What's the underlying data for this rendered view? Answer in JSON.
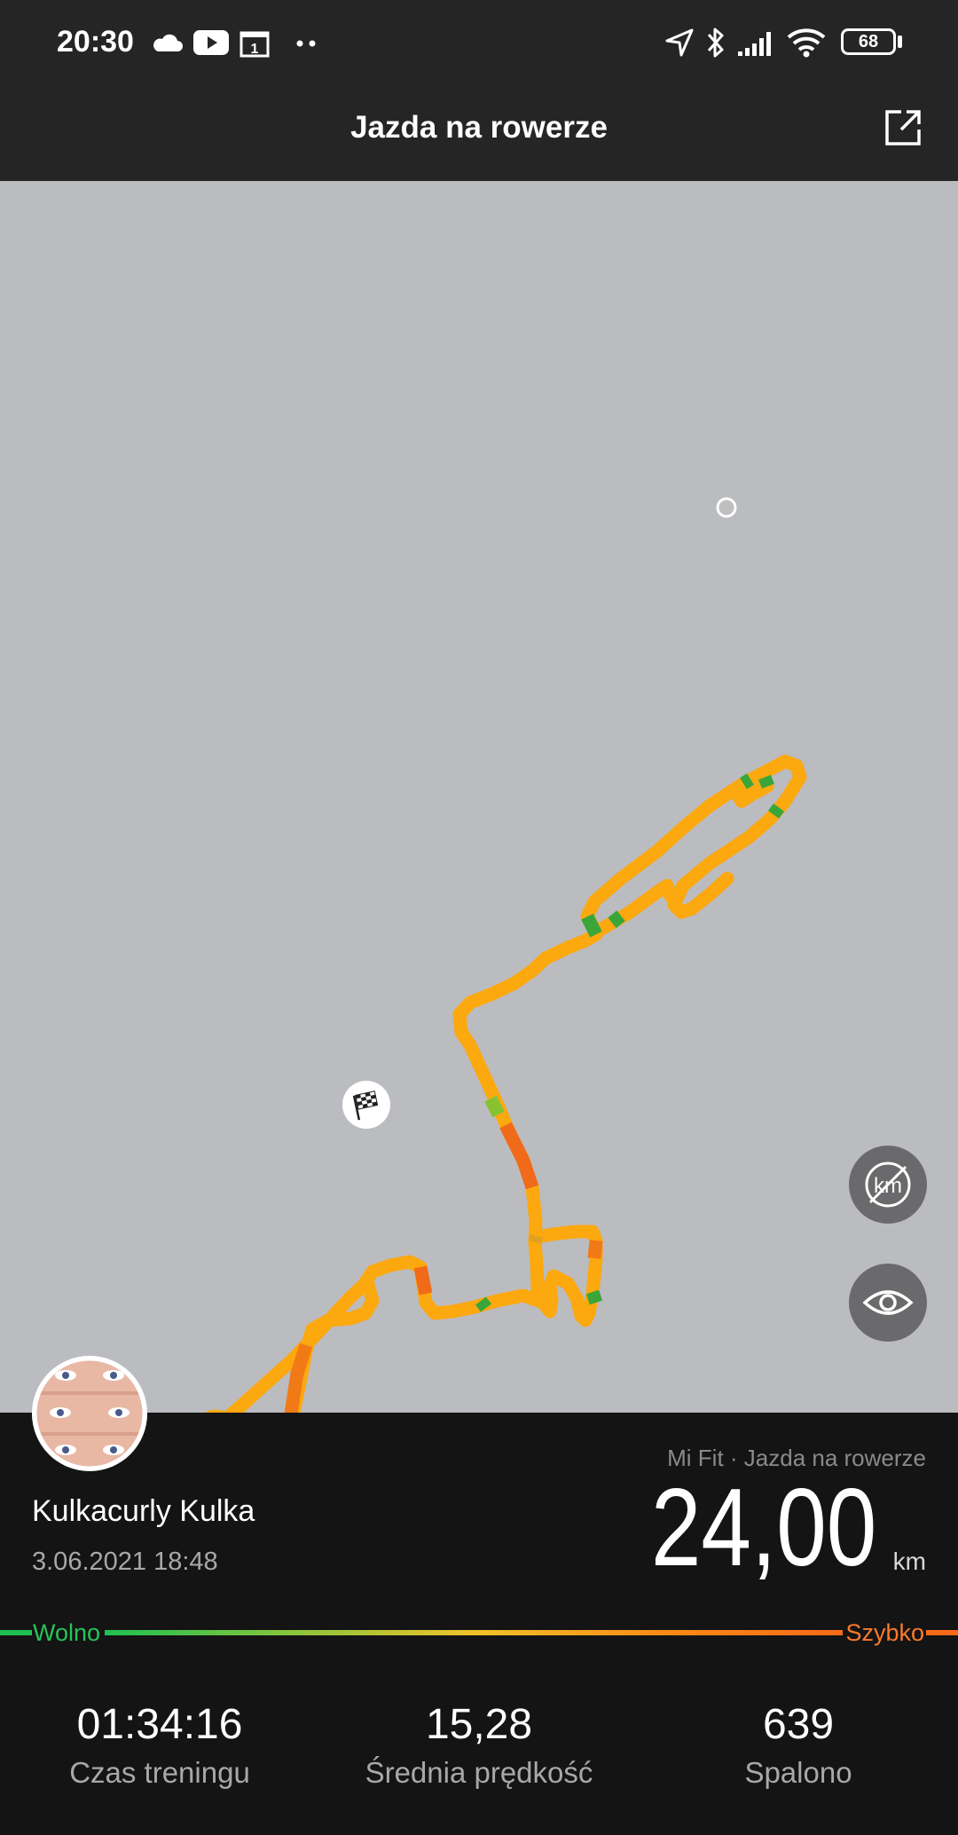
{
  "status_bar": {
    "time": "20:30",
    "battery": "68",
    "icons": [
      "cloud-icon",
      "youtube-icon",
      "calendar-icon",
      "more-dots-icon",
      "location-icon",
      "bluetooth-icon",
      "signal-icon",
      "wifi-icon",
      "battery-icon"
    ]
  },
  "header": {
    "title": "Jazda na rowerze",
    "share_icon": "share-icon"
  },
  "map": {
    "start_marker": "start-point-icon",
    "finish_marker": "finish-flag-icon",
    "buttons": [
      "hide-km-markers-icon",
      "visibility-eye-icon"
    ]
  },
  "summary": {
    "user_name": "Kulkacurly Kulka",
    "date": "3.06.2021 18:48",
    "source": "Mi Fit · Jazda na rowerze",
    "distance": "24,00",
    "distance_unit": "km"
  },
  "speed_legend": {
    "slow": "Wolno",
    "fast": "Szybko",
    "slow_color": "#1fc052",
    "fast_color": "#fa6a18"
  },
  "stats": [
    {
      "value": "01:34:16",
      "label": "Czas treningu"
    },
    {
      "value": "15,28",
      "label": "Średnia prędkość"
    },
    {
      "value": "639",
      "label": "Spalono"
    }
  ],
  "colors": {
    "route": "#fca80f",
    "map_background": "#bbbcc0",
    "bar_background": "#252525"
  }
}
